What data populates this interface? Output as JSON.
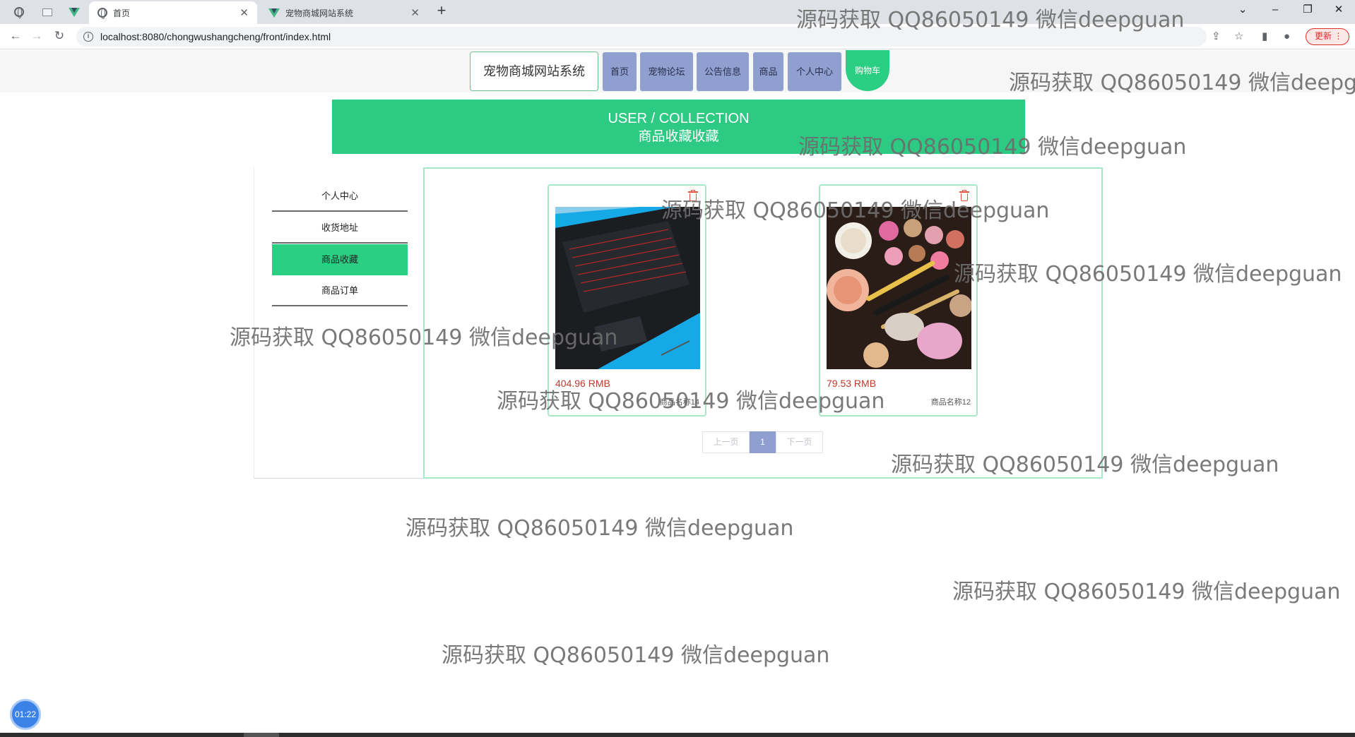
{
  "browser": {
    "tabs": [
      {
        "title": "首页",
        "active": true
      },
      {
        "title": "宠物商城网站系统",
        "active": false
      }
    ],
    "url": "localhost:8080/chongwushangcheng/front/index.html",
    "update_label": "更新"
  },
  "header": {
    "site_title": "宠物商城网站系统",
    "nav": [
      "首页",
      "宠物论坛",
      "公告信息",
      "商品",
      "个人中心"
    ],
    "cart_label": "购物车"
  },
  "banner": {
    "en": "USER / COLLECTION",
    "cn": "商品收藏收藏"
  },
  "sidebar": {
    "items": [
      {
        "label": "个人中心",
        "active": false
      },
      {
        "label": "收货地址",
        "active": false
      },
      {
        "label": "商品收藏",
        "active": true
      },
      {
        "label": "商品订单",
        "active": false
      }
    ]
  },
  "products": [
    {
      "price": "404.96 RMB",
      "name": "商品名称14",
      "image": "laptop-keyboard-photo"
    },
    {
      "price": "79.53 RMB",
      "name": "商品名称12",
      "image": "makeup-palette-photo"
    }
  ],
  "pagination": {
    "prev": "上一页",
    "current": "1",
    "next": "下一页"
  },
  "watermark_text": "源码获取 QQ86050149 微信deepguan",
  "watermark_text_cut": "源码获取 QQ86050149 微信deepgu",
  "watermark_text_partial": "源码获取 QQ86050149 微信deepguan",
  "timer": "01:22",
  "colors": {
    "accent_green": "#2bcf83",
    "nav_blue": "#8f9fd0",
    "price_red": "#c0392b"
  }
}
